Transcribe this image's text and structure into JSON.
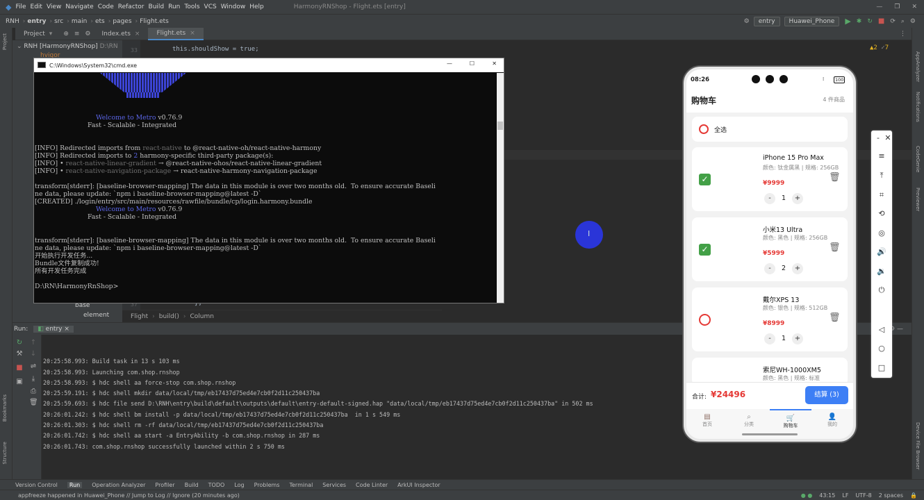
{
  "menubar": {
    "items": [
      "File",
      "Edit",
      "View",
      "Navigate",
      "Code",
      "Refactor",
      "Build",
      "Run",
      "Tools",
      "VCS",
      "Window",
      "Help"
    ],
    "window_title": "HarmonyRNShop - Flight.ets [entry]"
  },
  "navbar": {
    "crumbs": [
      "RNH",
      "entry",
      "src",
      "main",
      "ets",
      "pages",
      "Flight.ets"
    ],
    "run_config": "entry",
    "device": "Huawei_Phone"
  },
  "tabs": [
    "Project",
    "Index.ets",
    "Flight.ets"
  ],
  "inspections": {
    "warnings": "2",
    "weak": "7"
  },
  "project_tree": {
    "root": "RNH [HarmonyRNShop]",
    "root_path": "D:\\RN",
    "items": [
      "hvigor",
      "base",
      "element"
    ]
  },
  "editor": {
    "line_number": "33",
    "code_line_1": "this.shouldShow = true;",
    "code_line_2": "},",
    "bottom_line_number": "37",
    "breadcrumbs": [
      "Flight",
      "build()",
      "Column"
    ]
  },
  "cmd": {
    "title": "C:\\Windows\\System32\\cmd.exe",
    "welcome": "Welcome to Metro",
    "version": "v0.76.9",
    "tagline": "Fast - Scalable - Integrated",
    "info_lines": [
      "[INFO] Redirected imports from react-native to @react-native-oh/react-native-harmony",
      "[INFO] Redirected imports to 2 harmony-specific third-party package(s):",
      "[INFO] • react-native-linear-gradient → @react-native-ohos/react-native-linear-gradient",
      "[INFO] • react-native-navigation-package → react-native-harmony-navigation-package"
    ],
    "stderr_1a": "transform[stderr]: [baseline-browser-mapping] The data in this module is over two months old.  To ensure accurate Baseli",
    "stderr_1b": "ne data, please update: `npm i baseline-browser-mapping@latest -D`",
    "created": "[CREATED] ./login/entry/src/main/resources/rawfile/bundle/cp/login.harmony.bundle",
    "stderr_2a": "transform[stderr]: [baseline-browser-mapping] The data in this module is over two months old.  To ensure accurate Baseli",
    "stderr_2b": "ne data, please update: `npm i baseline-browser-mapping@latest -D`",
    "cn_1": "开始执行开发任务...",
    "cn_2": "Bundle文件复制成功!",
    "cn_3": "所有开发任务完成",
    "prompt": "D:\\RN\\HarmonyRnShop>"
  },
  "run": {
    "label": "Run:",
    "config": "entry",
    "logs": [
      "20:25:58.993: Build task in 13 s 103 ms",
      "20:25:58.993: Launching com.shop.rnshop",
      "20:25:58.993: $ hdc shell aa force-stop com.shop.rnshop",
      "20:25:59.191: $ hdc shell mkdir data/local/tmp/eb17437d75ed4e7cb0f2d11c250437ba",
      "20:25:59.693: $ hdc file send D:\\RNH\\entry\\build\\default\\outputs\\default\\entry-default-signed.hap \"data/local/tmp/eb17437d75ed4e7cb0f2d11c250437ba\" in 502 ms",
      "20:26:01.242: $ hdc shell bm install -p data/local/tmp/eb17437d75ed4e7cb0f2d11c250437ba  in 1 s 549 ms",
      "20:26:01.303: $ hdc shell rm -rf data/local/tmp/eb17437d75ed4e7cb0f2d11c250437ba",
      "20:26:01.742: $ hdc shell aa start -a EntryAbility -b com.shop.rnshop in 287 ms",
      "20:26:01.743: com.shop.rnshop successfully launched within 2 s 750 ms"
    ]
  },
  "bottom_tools": [
    "Version Control",
    "Run",
    "Operation Analyzer",
    "Profiler",
    "Build",
    "TODO",
    "Log",
    "Problems",
    "Terminal",
    "Services",
    "Code Linter",
    "ArkUI Inspector"
  ],
  "statusbar": {
    "message": "appfreeze happened in Huawei_Phone // Jump to Log // Ignore (20 minutes ago)",
    "position": "43:15",
    "line_sep": "LF",
    "encoding": "UTF-8",
    "indent": "2 spaces"
  },
  "side_labels": {
    "left": [
      "Project",
      "Bookmarks",
      "Structure"
    ],
    "right": [
      "AppAnalyzer",
      "Notifications",
      "CodeGenie",
      "Previewer",
      "Device File Browser"
    ]
  },
  "phone": {
    "time": "08:26",
    "battery": "100",
    "title": "购物车",
    "count": "4 件商品",
    "select_all": "全选",
    "items": [
      {
        "name": "iPhone 15 Pro Max",
        "spec": "颜色: 钛金属黑 | 规格: 256GB",
        "price": "¥9999",
        "qty": "1",
        "checked": true
      },
      {
        "name": "小米13 Ultra",
        "spec": "颜色: 黑色 | 规格: 256GB",
        "price": "¥5999",
        "qty": "2",
        "checked": true
      },
      {
        "name": "戴尔XPS 13",
        "spec": "颜色: 银色 | 规格: 512GB",
        "price": "¥8999",
        "qty": "1",
        "checked": false
      },
      {
        "name": "索尼WH-1000XM5",
        "spec": "颜色: 黑色 | 规格: 标准",
        "price": "",
        "qty": "",
        "checked": false
      }
    ],
    "total_label": "合计:",
    "total": "¥24496",
    "checkout": "结算 (3)",
    "tabs": [
      "首页",
      "分类",
      "购物车",
      "我的"
    ],
    "minus": "-",
    "plus": "+"
  },
  "colors": {
    "ide_bg": "#2b2b2b",
    "ide_panel": "#3c3f41",
    "accent": "#4a88c7",
    "price_red": "#e53935",
    "check_green": "#43a047",
    "checkout_blue": "#3d7ff5",
    "cursor_blue": "#2a35d8"
  }
}
